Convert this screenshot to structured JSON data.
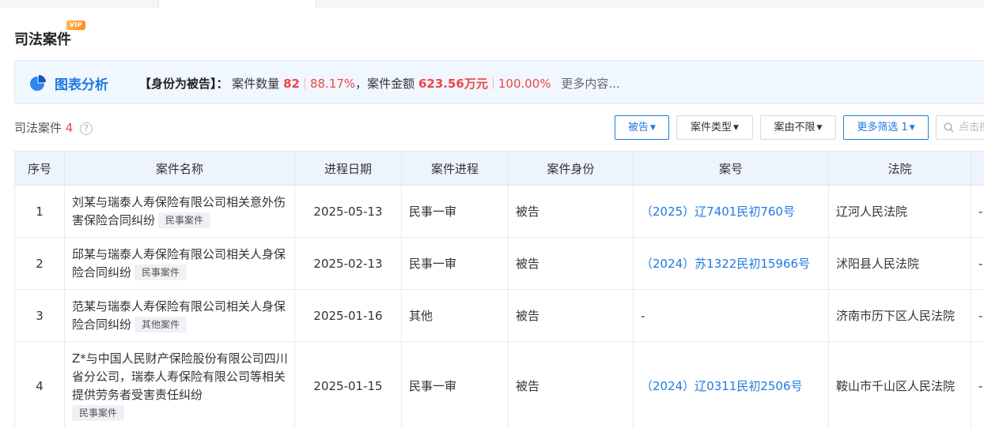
{
  "section": {
    "title": "司法案件",
    "vip_badge": "VIP"
  },
  "chart_summary": {
    "label": "图表分析",
    "role": "【身份为被告】：",
    "count_label": "案件数量",
    "count": "82",
    "count_pct": "88.17%",
    "amount_label": "，案件金额",
    "amount": "623.56万元",
    "amount_pct": "100.00%",
    "more": "更多内容..."
  },
  "list": {
    "title": "司法案件",
    "count": "4",
    "help": "?"
  },
  "filters": {
    "role": "被告",
    "case_type": "案件类型",
    "cause": "案由不限",
    "more": "更多筛选 1",
    "search_placeholder": "点击搜"
  },
  "columns": [
    "序号",
    "案件名称",
    "进程日期",
    "案件进程",
    "案件身份",
    "案号",
    "法院"
  ],
  "rows": [
    {
      "no": "1",
      "name": "刘某与瑞泰人寿保险有限公司相关意外伤害保险合同纠纷",
      "tag": "民事案件",
      "date": "2025-05-13",
      "stage": "民事一审",
      "role": "被告",
      "case_no": "（2025）辽7401民初760号",
      "court": "辽河人民法院",
      "extra": "-"
    },
    {
      "no": "2",
      "name": "邱某与瑞泰人寿保险有限公司相关人身保险合同纠纷",
      "tag": "民事案件",
      "date": "2025-02-13",
      "stage": "民事一审",
      "role": "被告",
      "case_no": "（2024）苏1322民初15966号",
      "court": "沭阳县人民法院",
      "extra": "-"
    },
    {
      "no": "3",
      "name": "范某与瑞泰人寿保险有限公司相关人身保险合同纠纷",
      "tag": "其他案件",
      "date": "2025-01-16",
      "stage": "其他",
      "role": "被告",
      "case_no": "-",
      "court": "济南市历下区人民法院",
      "extra": "-"
    },
    {
      "no": "4",
      "name": "Z*与中国人民财产保险股份有限公司四川省分公司，瑞泰人寿保险有限公司等相关提供劳务者受害责任纠纷",
      "tag": "民事案件",
      "date": "2025-01-15",
      "stage": "民事一审",
      "role": "被告",
      "case_no": "（2024）辽0311民初2506号",
      "court": "鞍山市千山区人民法院",
      "extra": "-"
    }
  ],
  "colors": {
    "accent": "#1f7ae0",
    "red": "#f04444",
    "header_bg": "#edf4fd"
  }
}
